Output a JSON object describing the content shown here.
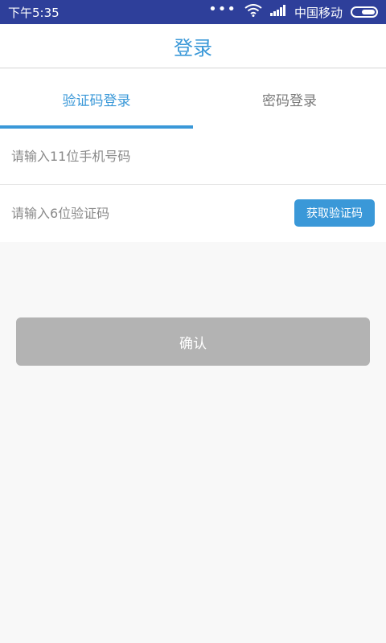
{
  "status_bar": {
    "time": "下午5:35",
    "carrier": "中国移动",
    "dots": "•••",
    "battery_level": 0.6
  },
  "header": {
    "title": "登录"
  },
  "tabs": [
    {
      "label": "验证码登录",
      "active": true
    },
    {
      "label": "密码登录",
      "active": false
    }
  ],
  "form": {
    "phone_placeholder": "请输入11位手机号码",
    "code_placeholder": "请输入6位验证码",
    "get_code_label": "获取验证码"
  },
  "actions": {
    "confirm_label": "确认"
  },
  "colors": {
    "accent": "#3a98d8",
    "status_bar": "#2e3f9a",
    "disabled_button": "#b3b3b3"
  }
}
